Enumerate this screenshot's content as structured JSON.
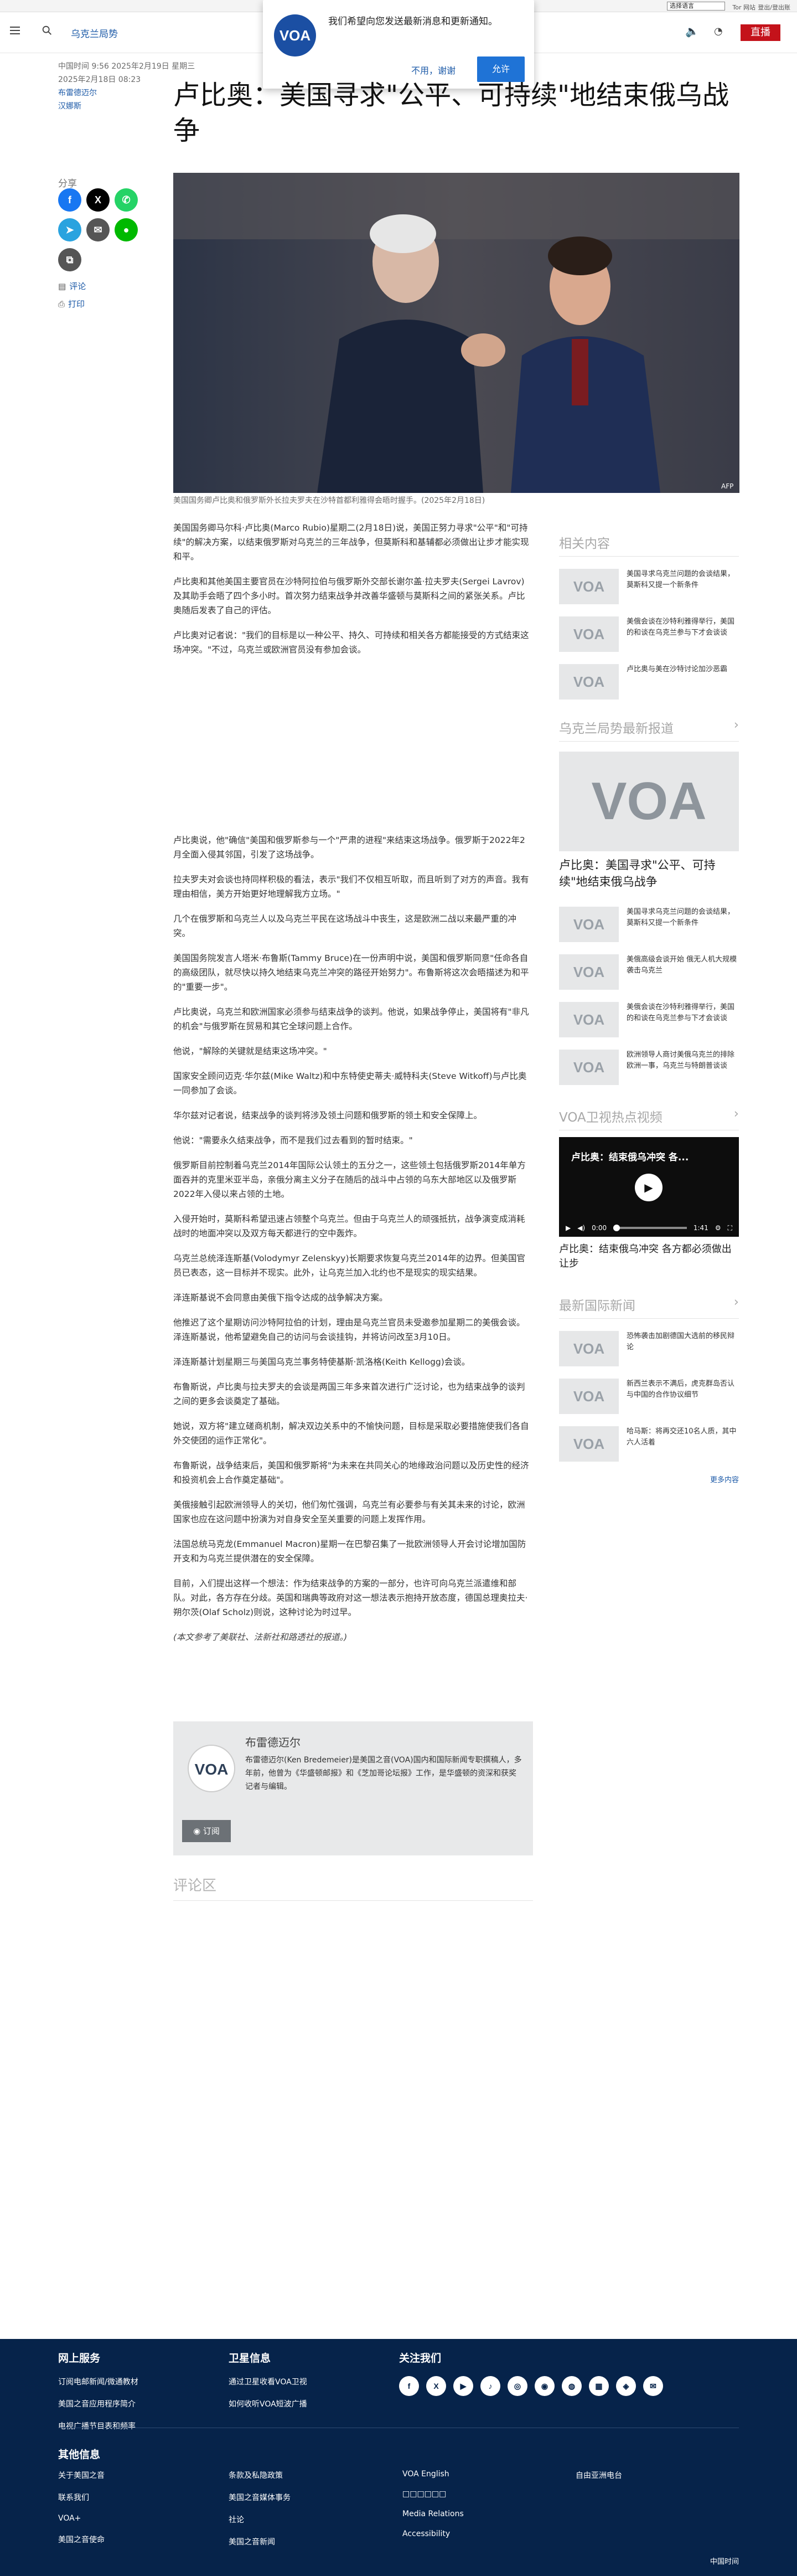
{
  "utility": {
    "language_select": "选择语言",
    "tor_link": "Tor 网站",
    "logout": "登出/登出账"
  },
  "header": {
    "breadcrumb": "乌克兰局势",
    "live_label": "直播"
  },
  "notification": {
    "message": "我们希望向您发送最新消息和更新通知。",
    "decline": "不用，谢谢",
    "allow": "允许",
    "logo_text": "VOA"
  },
  "meta": {
    "timestamp": "中国时间 9:56 2025年2月19日 星期三",
    "update": "2025年2月18日 08:23",
    "author": "布雷德迈尔",
    "source": "汉娜斯"
  },
  "article": {
    "title": "卢比奥：美国寻求\"公平、可持续\"地结束俄乌战争",
    "caption": "美国国务卿卢比奥和俄罗斯外长拉夫罗夫在沙特首都利雅得会晤时握手。(2025年2月18日)",
    "paragraphs_top": [
      "美国国务卿马尔科·卢比奥(Marco Rubio)星期二(2月18日)说，美国正努力寻求\"公平\"和\"可持续\"的解决方案，以结束俄罗斯对乌克兰的三年战争，但莫斯科和基辅都必须做出让步才能实现和平。",
      "卢比奥和其他美国主要官员在沙特阿拉伯与俄罗斯外交部长谢尔盖·拉夫罗夫(Sergei Lavrov)及其助手会晤了四个多小时。首次努力结束战争并改善华盛顿与莫斯科之间的紧张关系。卢比奥随后发表了自己的评估。",
      "卢比奥对记者说：\"我们的目标是以一种公平、持久、可持续和相关各方都能接受的方式结束这场冲突。\"不过，乌克兰或欧洲官员没有参加会谈。"
    ],
    "paragraphs_bottom": [
      "卢比奥说，他\"确信\"美国和俄罗斯参与一个\"严肃的进程\"来结束这场战争。俄罗斯于2022年2月全面入侵其邻国，引发了这场战争。",
      "拉夫罗夫对会谈也持同样积极的看法，表示\"我们不仅相互听取，而且听到了对方的声音。我有理由相信，美方开始更好地理解我方立场。\"",
      "几个在俄罗斯和乌克兰人以及乌克兰平民在这场战斗中丧生，这是欧洲二战以来最严重的冲突。",
      "美国国务院发言人塔米·布鲁斯(Tammy Bruce)在一份声明中说，美国和俄罗斯同意\"任命各自的高级团队，就尽快以持久地结束乌克兰冲突的路径开始努力\"。布鲁斯将这次会晤描述为和平的\"重要一步\"。",
      "卢比奥说，乌克兰和欧洲国家必须参与结束战争的谈判。他说，如果战争停止，美国将有\"非凡的机会\"与俄罗斯在贸易和其它全球问题上合作。",
      "他说，\"解除的关键就是结束这场冲突。\"",
      "国家安全顾问迈克·华尔兹(Mike Waltz)和中东特使史蒂夫·威特科夫(Steve Witkoff)与卢比奥一同参加了会谈。",
      "华尔兹对记者说，结束战争的谈判将涉及领土问题和俄罗斯的领土和安全保障上。",
      "他说：\"需要永久结束战争，而不是我们过去看到的暂时结束。\"",
      "俄罗斯目前控制着乌克兰2014年国际公认领土的五分之一，这些领土包括俄罗斯2014年单方面吞并的克里米亚半岛，亲俄分离主义分子在随后的战斗中占领的乌东大部地区以及俄罗斯2022年入侵以来占领的土地。",
      "入侵开始时，莫斯科希望迅速占领整个乌克兰。但由于乌克兰人的顽强抵抗，战争演变成消耗战时的地面冲突以及双方每天都进行的空中轰炸。",
      "乌克兰总统泽连斯基(Volodymyr Zelenskyy)长期要求恢复乌克兰2014年的边界。但美国官员已表态，这一目标并不现实。此外，让乌克兰加入北约也不是现实的现实结果。",
      "泽连斯基说不会同意由美俄下指令达成的战争解决方案。",
      "他推迟了这个星期访问沙特阿拉伯的计划，理由是乌克兰官员未受邀参加星期二的美俄会谈。泽连斯基说，他希望避免自己的访问与会谈挂钩，并将访问改至3月10日。",
      "泽连斯基计划星期三与美国乌克兰事务特使基斯·凯洛格(Keith Kellogg)会谈。",
      "布鲁斯说，卢比奥与拉夫罗夫的会谈是两国三年多来首次进行广泛讨论，也为结束战争的谈判之间的更多会谈奠定了基础。",
      "她说，双方将\"建立磋商机制，解决双边关系中的不愉快问题，目标是采取必要措施使我们各自外交使团的运作正常化\"。",
      "布鲁斯说，战争结束后，美国和俄罗斯将\"为未来在共同关心的地缘政治问题以及历史性的经济和投资机会上合作奠定基础\"。",
      "美俄接触引起欧洲领导人的关切，他们匆忙强调，乌克兰有必要参与有关其未来的讨论，欧洲国家也应在这问题中扮演为对自身安全至关重要的问题上发挥作用。",
      "法国总统马克龙(Emmanuel Macron)星期一在巴黎召集了一批欧洲领导人开会讨论增加国防开支和为乌克兰提供潜在的安全保障。",
      "目前，入们提出这样一个想法：作为结束战争的方案的一部分，也许可向乌克兰派遣维和部队。对此，各方存在分歧。英国和瑞典等政府对这一想法表示抱持开放态度，德国总理奥拉夫·朔尔茨(Olaf Scholz)则说，这种讨论为时过早。"
    ],
    "note": "(本文参考了美联社、法新社和路透社的报道。)"
  },
  "share": {
    "label": "分享",
    "comment": "评论",
    "print": "打印"
  },
  "author_box": {
    "name": "布雷德迈尔",
    "bio": "布雷德迈尔(Ken Bredemeier)是美国之音(VOA)国内和国际新闻专职撰稿人，多年前，他曾为《华盛顿邮报》和《芝加哥论坛报》工作，是华盛顿的资深和获奖记者与编辑。",
    "subscribe": "订阅",
    "avatar_text": "VOA"
  },
  "comments_label": "评论区",
  "rail": {
    "related_title": "相关内容",
    "related": [
      "美国寻求乌克兰问题的会谈结果，莫斯科又提一个新条件",
      "美俄会谈在沙特利雅得举行，美国的和谈在乌克兰参与下才会谈谈",
      "卢比奥与美在沙特讨论加沙恶霸"
    ],
    "latest_title": "乌克兰局势最新报道",
    "latest_feature": "卢比奥：美国寻求\"公平、可持续\"地结束俄乌战争",
    "latest": [
      "美国寻求乌克兰问题的会谈结果，莫斯科又提一个新条件",
      "美俄高级会谈开始 俄无人机大规模袭击乌克兰",
      "美俄会谈在沙特利雅得举行，美国的和谈在乌克兰参与下才会谈谈",
      "欧洲领导人商讨美俄乌克兰的排除欧洲一事，乌克兰与特朗普谈谈"
    ],
    "video_title": "VOA卫视热点视频",
    "video_overlay": "卢比奥：结束俄乌冲突 各...",
    "video_time": "0:00",
    "video_duration": "1:41",
    "video_caption": "卢比奥：结束俄乌冲突 各方都必须做出让步",
    "intl_title": "最新国际新闻",
    "intl": [
      "恐怖袭击加剧德国大选前的移民辩论",
      "新西兰表示不满后，虎克群岛否认与中国的合作协议细节",
      "哈马斯：将再交还10名人质，其中六人活着"
    ],
    "more": "更多内容",
    "thumb_text": "VOA"
  },
  "footer": {
    "col1_title": "网上服务",
    "col1": [
      "订阅电邮新闻/微通教材",
      "美国之音应用程序简介",
      "电视广播节目表和频率"
    ],
    "col2_title": "卫星信息",
    "col2": [
      "通过卫星收看VOA卫视",
      "如何收听VOA短波广播"
    ],
    "col3_title": "关注我们",
    "social": [
      "f",
      "X",
      "▶",
      "♪",
      "◎",
      "◉",
      "◍",
      "▦",
      "◈",
      "✉"
    ],
    "other_title": "其他信息",
    "other": [
      "关于美国之音",
      "联系我们",
      "VOA+",
      "美国之音使命",
      "条款及私隐政策",
      "美国之音媒体事务",
      "社论",
      "美国之音新闻",
      "VOA English",
      "□□□□□□",
      "Media Relations",
      "Accessibility",
      "自由亚洲电台"
    ],
    "copyright": "中国时间"
  }
}
